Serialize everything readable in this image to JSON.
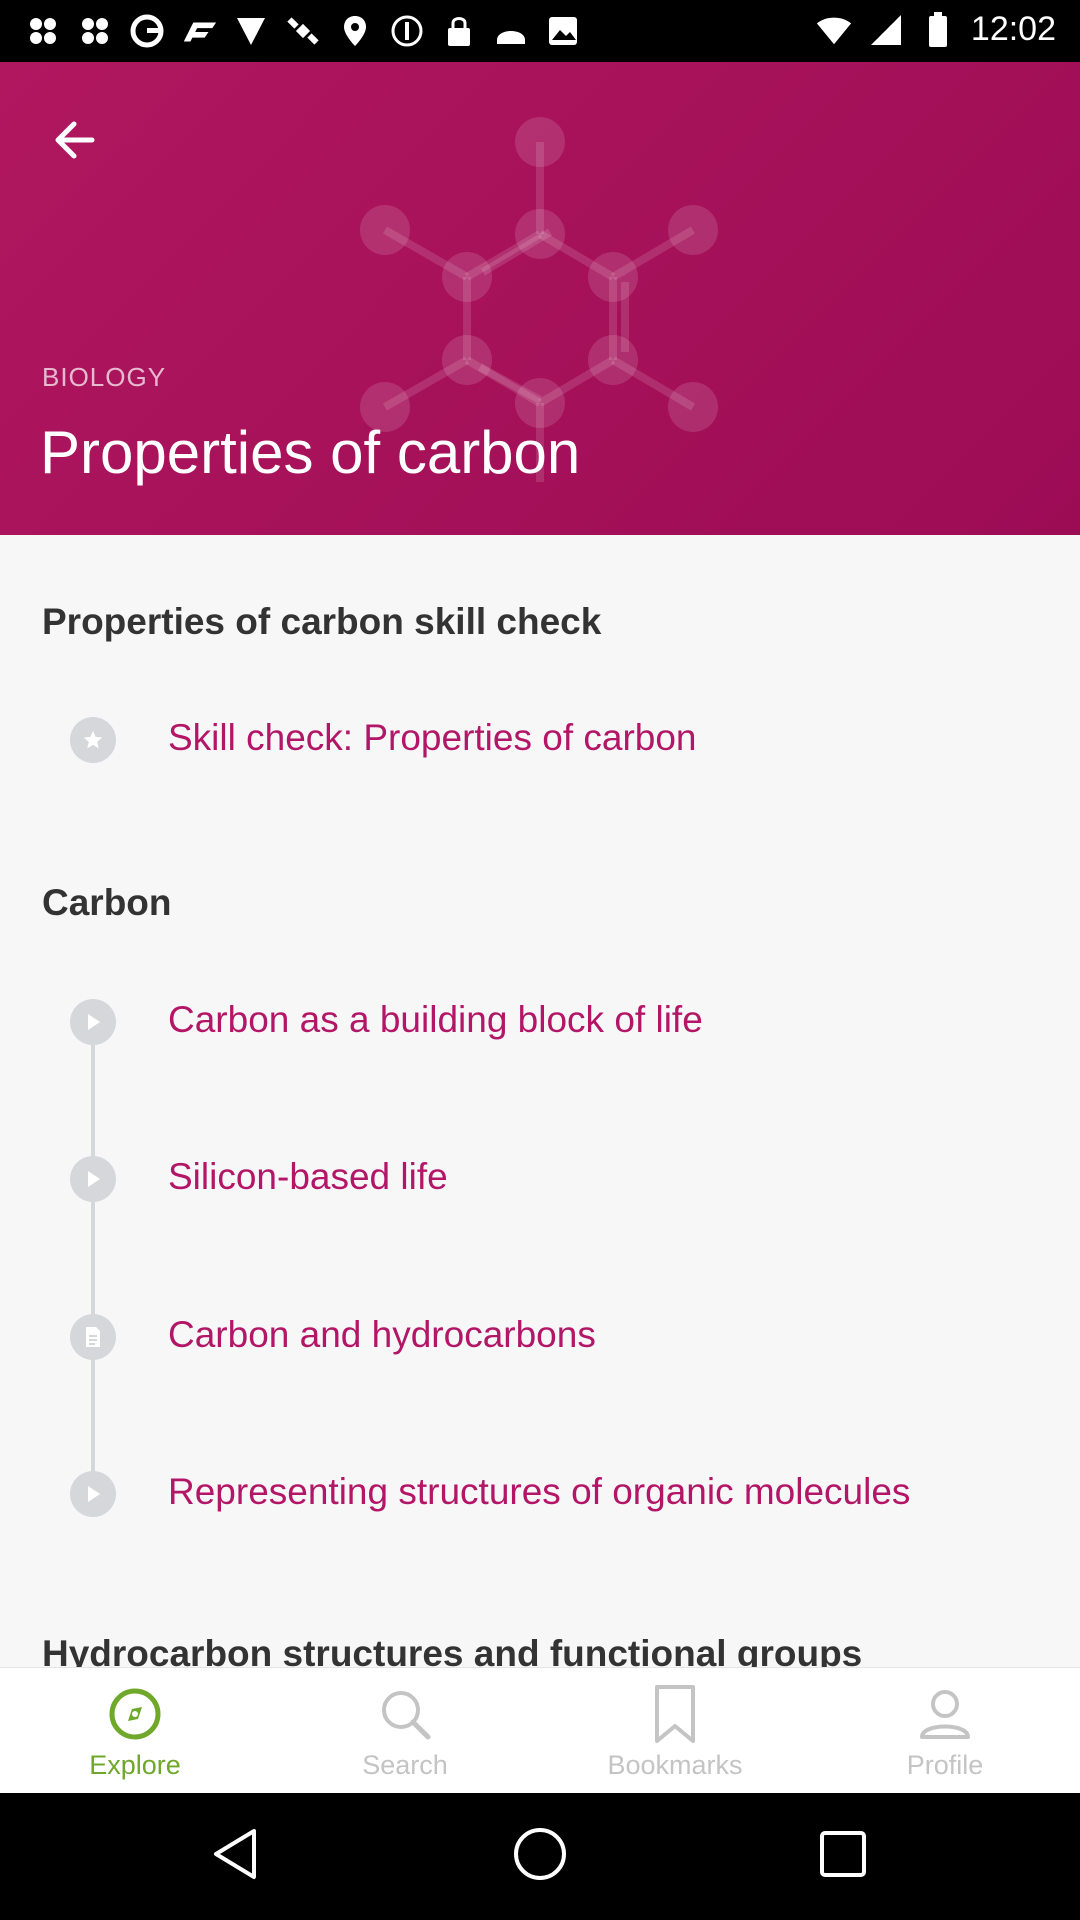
{
  "status_bar": {
    "time": "12:02",
    "left_icons": [
      "slack-icon",
      "slack-icon",
      "circle-g-icon",
      "f1-icon",
      "shield-icon",
      "satellite-icon",
      "location-icon",
      "do-not-disturb-icon",
      "lock-icon",
      "android-icon",
      "image-icon"
    ],
    "right_icons": [
      "wifi-icon",
      "signal-icon",
      "battery-icon"
    ]
  },
  "header": {
    "subject": "BIOLOGY",
    "title": "Properties of carbon",
    "background_color": "#a3105a"
  },
  "sections": [
    {
      "title": "Properties of carbon skill check",
      "items": [
        {
          "label": "Skill check: Properties of carbon",
          "icon": "star-icon"
        }
      ]
    },
    {
      "title": "Carbon",
      "items": [
        {
          "label": "Carbon as a building block of life",
          "icon": "play-icon"
        },
        {
          "label": "Silicon-based life",
          "icon": "play-icon"
        },
        {
          "label": "Carbon and hydrocarbons",
          "icon": "article-icon"
        },
        {
          "label": "Representing structures of organic molecules",
          "icon": "play-icon"
        }
      ]
    },
    {
      "title": "Hydrocarbon structures and functional groups",
      "items": []
    }
  ],
  "bottom_nav": [
    {
      "label": "Explore",
      "icon": "compass-icon",
      "active": true
    },
    {
      "label": "Search",
      "icon": "search-icon",
      "active": false
    },
    {
      "label": "Bookmarks",
      "icon": "bookmark-icon",
      "active": false
    },
    {
      "label": "Profile",
      "icon": "person-icon",
      "active": false
    }
  ],
  "colors": {
    "accent": "#b31667",
    "active_nav": "#6fa82a",
    "inactive_nav": "#c4c4c4"
  }
}
